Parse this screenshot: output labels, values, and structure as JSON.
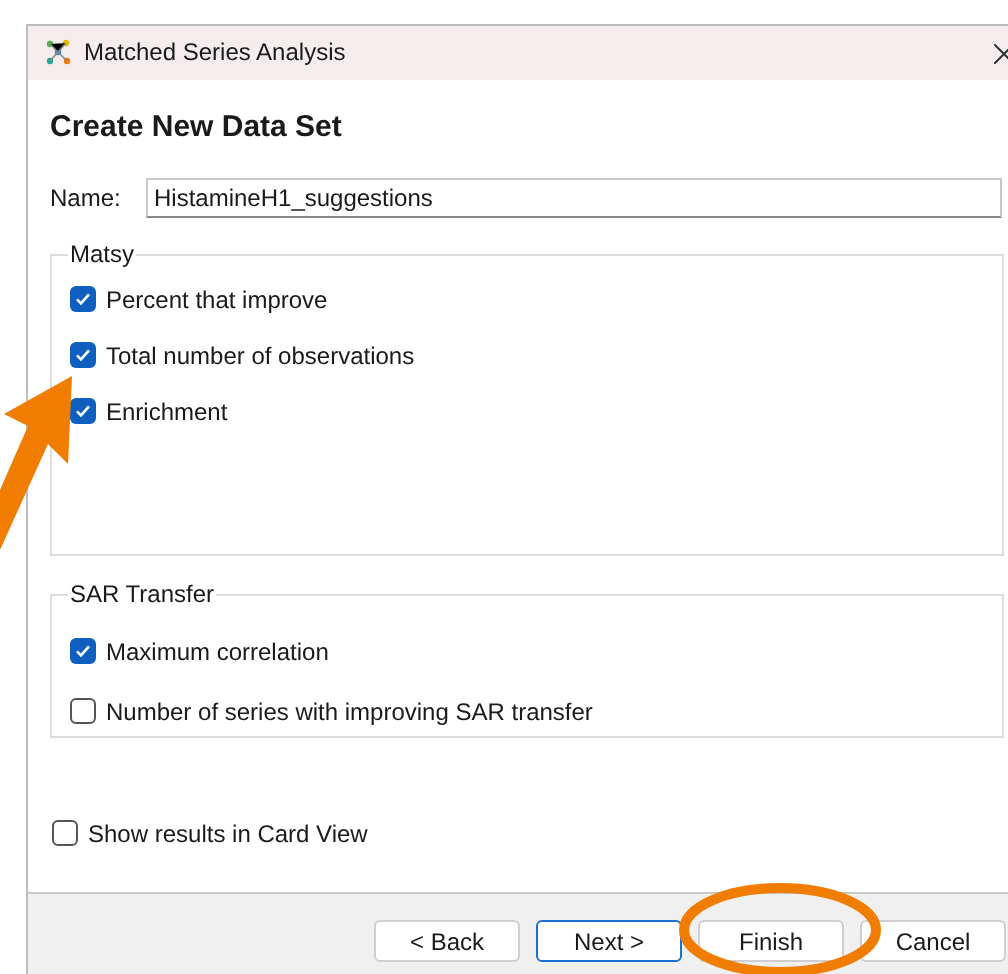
{
  "window": {
    "title": "Matched Series Analysis"
  },
  "heading": "Create New Data Set",
  "name_field": {
    "label": "Name:",
    "value": "HistamineH1_suggestions"
  },
  "groups": [
    {
      "title": "Matsy",
      "items": [
        {
          "label": "Percent that improve",
          "checked": true
        },
        {
          "label": "Total number of observations",
          "checked": true
        },
        {
          "label": "Enrichment",
          "checked": true
        }
      ]
    },
    {
      "title": "SAR Transfer",
      "items": [
        {
          "label": "Maximum correlation",
          "checked": true
        },
        {
          "label": "Number of series with improving SAR transfer",
          "checked": false
        }
      ]
    }
  ],
  "option": {
    "label": "Show results in Card View",
    "checked": false
  },
  "buttons": [
    {
      "label": "< Back",
      "default": false
    },
    {
      "label": "Next >",
      "default": true
    },
    {
      "label": "Finish",
      "default": false
    },
    {
      "label": "Cancel",
      "default": false
    }
  ]
}
